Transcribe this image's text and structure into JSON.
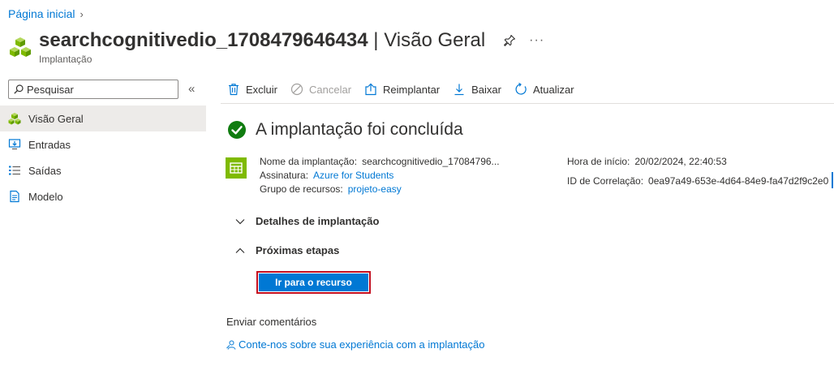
{
  "breadcrumb": {
    "home": "Página inicial"
  },
  "header": {
    "resource_name": "searchcognitivedio_1708479646434",
    "separator": " | ",
    "view": "Visão Geral",
    "subtitle": "Implantação",
    "more": "···",
    "icon": "deployment-cubes-icon"
  },
  "search": {
    "placeholder": "Pesquisar",
    "collapse": "«"
  },
  "nav": {
    "items": [
      {
        "label": "Visão Geral",
        "icon": "overview-icon",
        "active": true
      },
      {
        "label": "Entradas",
        "icon": "inputs-icon"
      },
      {
        "label": "Saídas",
        "icon": "outputs-icon"
      },
      {
        "label": "Modelo",
        "icon": "template-icon"
      }
    ]
  },
  "toolbar": {
    "delete": "Excluir",
    "cancel": "Cancelar",
    "redeploy": "Reimplantar",
    "download": "Baixar",
    "refresh": "Atualizar"
  },
  "status": {
    "title": "A implantação foi concluída",
    "color": "#107c10"
  },
  "details": {
    "name_label": "Nome da implantação:",
    "name_value": "searchcognitivedio_17084796...",
    "subscription_label": "Assinatura:",
    "subscription_value": "Azure for Students",
    "group_label": "Grupo de recursos:",
    "group_value": "projeto-easy",
    "start_label": "Hora de início:",
    "start_value": "20/02/2024, 22:40:53",
    "correlation_label": "ID de Correlação:",
    "correlation_value": "0ea97a49-653e-4d64-84e9-fa47d2f9c2e0"
  },
  "sections": {
    "deployment_details": "Detalhes de implantação",
    "next_steps": "Próximas etapas"
  },
  "cta": {
    "label": "Ir para o recurso",
    "color": "#0078d4",
    "highlight": "#c50f1f"
  },
  "feedback": {
    "title": "Enviar comentários",
    "link": "Conte-nos sobre sua experiência com a implantação"
  },
  "colors": {
    "accent": "#0078d4",
    "success": "#107c10",
    "resource": "#7fba00"
  }
}
